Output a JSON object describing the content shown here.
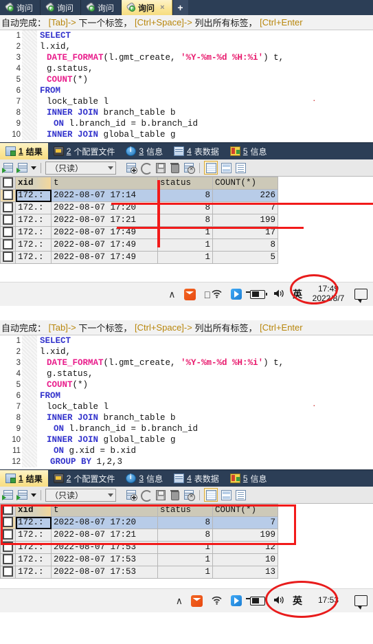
{
  "window": {
    "tabs": [
      {
        "label": "询问",
        "active": false
      },
      {
        "label": "询问",
        "active": false
      },
      {
        "label": "询问",
        "active": false
      },
      {
        "label": "询问",
        "active": true
      }
    ],
    "close_glyph": "×",
    "new_tab_label": "+"
  },
  "hint": {
    "prefix": "自动完成：",
    "k1": "[Tab]->",
    "t1": "下一个标签，",
    "k2": "[Ctrl+Space]->",
    "t2": "列出所有标签，",
    "k3": "[Ctrl+Enter"
  },
  "panel_top": {
    "sql_lines": [
      {
        "n": "1",
        "indent": 0,
        "tokens": [
          {
            "t": "SELECT",
            "c": "kw"
          }
        ]
      },
      {
        "n": "2",
        "indent": 0,
        "tokens": [
          {
            "t": "l.xid,",
            "c": "pl"
          }
        ]
      },
      {
        "n": "3",
        "indent": 1,
        "tokens": [
          {
            "t": "DATE_FORMAT",
            "c": "fn"
          },
          {
            "t": "(l.gmt_create, ",
            "c": "pl"
          },
          {
            "t": "'%Y-%m-%d %H:%i'",
            "c": "str"
          },
          {
            "t": ") t,",
            "c": "pl"
          }
        ]
      },
      {
        "n": "4",
        "indent": 1,
        "tokens": [
          {
            "t": "g.status,",
            "c": "pl"
          }
        ]
      },
      {
        "n": "5",
        "indent": 1,
        "tokens": [
          {
            "t": "COUNT",
            "c": "fn"
          },
          {
            "t": "(*)",
            "c": "pl"
          }
        ]
      },
      {
        "n": "6",
        "indent": 0,
        "tokens": [
          {
            "t": "FROM",
            "c": "kw"
          }
        ]
      },
      {
        "n": "7",
        "indent": 1,
        "tokens": [
          {
            "t": "lock_table l",
            "c": "pl"
          }
        ]
      },
      {
        "n": "8",
        "indent": 1,
        "tokens": [
          {
            "t": "INNER JOIN",
            "c": "kw"
          },
          {
            "t": " branch_table b",
            "c": "pl"
          }
        ]
      },
      {
        "n": "9",
        "indent": 2,
        "tokens": [
          {
            "t": "ON",
            "c": "kw"
          },
          {
            "t": " l.branch_id = b.branch_id",
            "c": "pl"
          }
        ]
      },
      {
        "n": "10",
        "indent": 1,
        "tokens": [
          {
            "t": "INNER JOIN",
            "c": "kw"
          },
          {
            "t": " global_table g",
            "c": "pl"
          }
        ]
      }
    ],
    "result_tabs": [
      {
        "num": "1",
        "label": "结果",
        "icon": "grid-icon",
        "active": true
      },
      {
        "num": "2",
        "label": "个配置文件",
        "icon": "profile-icon",
        "active": false
      },
      {
        "num": "3",
        "label": "信息",
        "icon": "info-icon",
        "active": false
      },
      {
        "num": "4",
        "label": "表数据",
        "icon": "table-icon",
        "active": false
      },
      {
        "num": "5",
        "label": "信息",
        "icon": "status-icon",
        "active": false
      }
    ],
    "toolbar": {
      "readonly_label": "（只读）"
    },
    "grid": {
      "columns": [
        "xid",
        "t",
        "status",
        "COUNT(*)"
      ],
      "rows": [
        {
          "xid": "172.:",
          "t": "2022-08-07 17:14",
          "status": "8",
          "count": "226",
          "selected": true
        },
        {
          "xid": "172.:",
          "t": "2022-08-07 17:20",
          "status": "8",
          "count": "7",
          "selected": false
        },
        {
          "xid": "172.:",
          "t": "2022-08-07 17:21",
          "status": "8",
          "count": "199",
          "selected": false
        },
        {
          "xid": "172.:",
          "t": "2022-08-07 17:49",
          "status": "1",
          "count": "17",
          "selected": false
        },
        {
          "xid": "172.:",
          "t": "2022-08-07 17:49",
          "status": "1",
          "count": "8",
          "selected": false
        },
        {
          "xid": "172.:",
          "t": "2022-08-07 17:49",
          "status": "1",
          "count": "5",
          "selected": false
        }
      ]
    },
    "taskbar": {
      "chevron": "∧",
      "wifi": "📶",
      "speaker": "⏷",
      "ime": "英",
      "time": "17:49",
      "date": "2022/8/7"
    }
  },
  "panel_bottom": {
    "sql_lines": [
      {
        "n": "1",
        "indent": 0,
        "tokens": [
          {
            "t": "SELECT",
            "c": "kw"
          }
        ]
      },
      {
        "n": "2",
        "indent": 0,
        "tokens": [
          {
            "t": "l.xid,",
            "c": "pl"
          }
        ]
      },
      {
        "n": "3",
        "indent": 1,
        "tokens": [
          {
            "t": "DATE_FORMAT",
            "c": "fn"
          },
          {
            "t": "(l.gmt_create, ",
            "c": "pl"
          },
          {
            "t": "'%Y-%m-%d %H:%i'",
            "c": "str"
          },
          {
            "t": ") t,",
            "c": "pl"
          }
        ]
      },
      {
        "n": "4",
        "indent": 1,
        "tokens": [
          {
            "t": "g.status,",
            "c": "pl"
          }
        ]
      },
      {
        "n": "5",
        "indent": 1,
        "tokens": [
          {
            "t": "COUNT",
            "c": "fn"
          },
          {
            "t": "(*)",
            "c": "pl"
          }
        ]
      },
      {
        "n": "6",
        "indent": 0,
        "tokens": [
          {
            "t": "FROM",
            "c": "kw"
          }
        ]
      },
      {
        "n": "7",
        "indent": 1,
        "tokens": [
          {
            "t": "lock_table l",
            "c": "pl"
          }
        ]
      },
      {
        "n": "8",
        "indent": 1,
        "tokens": [
          {
            "t": "INNER JOIN",
            "c": "kw"
          },
          {
            "t": " branch_table b",
            "c": "pl"
          }
        ]
      },
      {
        "n": "9",
        "indent": 2,
        "tokens": [
          {
            "t": "ON",
            "c": "kw"
          },
          {
            "t": " l.branch_id = b.branch_id",
            "c": "pl"
          }
        ]
      },
      {
        "n": "10",
        "indent": 1,
        "tokens": [
          {
            "t": "INNER JOIN",
            "c": "kw"
          },
          {
            "t": " global_table g",
            "c": "pl"
          }
        ]
      },
      {
        "n": "11",
        "indent": 2,
        "tokens": [
          {
            "t": "ON",
            "c": "kw"
          },
          {
            "t": " g.xid = b.xid",
            "c": "pl"
          }
        ]
      },
      {
        "n": "12",
        "indent": 0,
        "tokens": [
          {
            "t": "  GROUP BY",
            "c": "kw"
          },
          {
            "t": " 1,2,3",
            "c": "pl"
          }
        ]
      }
    ],
    "result_tabs": [
      {
        "num": "1",
        "label": "结果",
        "icon": "grid-icon",
        "active": true
      },
      {
        "num": "2",
        "label": "个配置文件",
        "icon": "profile-icon",
        "active": false
      },
      {
        "num": "3",
        "label": "信息",
        "icon": "info-icon",
        "active": false
      },
      {
        "num": "4",
        "label": "表数据",
        "icon": "table-icon",
        "active": false
      },
      {
        "num": "5",
        "label": "信息",
        "icon": "status-icon",
        "active": false
      }
    ],
    "toolbar": {
      "readonly_label": "（只读）"
    },
    "grid": {
      "columns": [
        "xid",
        "t",
        "status",
        "COUNT(*)"
      ],
      "rows": [
        {
          "xid": "172.:",
          "t": "2022-08-07 17:20",
          "status": "8",
          "count": "7",
          "selected": true
        },
        {
          "xid": "172.:",
          "t": "2022-08-07 17:21",
          "status": "8",
          "count": "199",
          "selected": false
        },
        {
          "xid": "172.:",
          "t": "2022-08-07 17:53",
          "status": "1",
          "count": "12",
          "selected": false
        },
        {
          "xid": "172.:",
          "t": "2022-08-07 17:53",
          "status": "1",
          "count": "10",
          "selected": false
        },
        {
          "xid": "172.:",
          "t": "2022-08-07 17:53",
          "status": "1",
          "count": "13",
          "selected": false
        }
      ]
    },
    "taskbar": {
      "chevron": "∧",
      "speaker": "⏷",
      "ime": "英",
      "time": "17:53"
    }
  },
  "annotation_color": "#f21a1a"
}
